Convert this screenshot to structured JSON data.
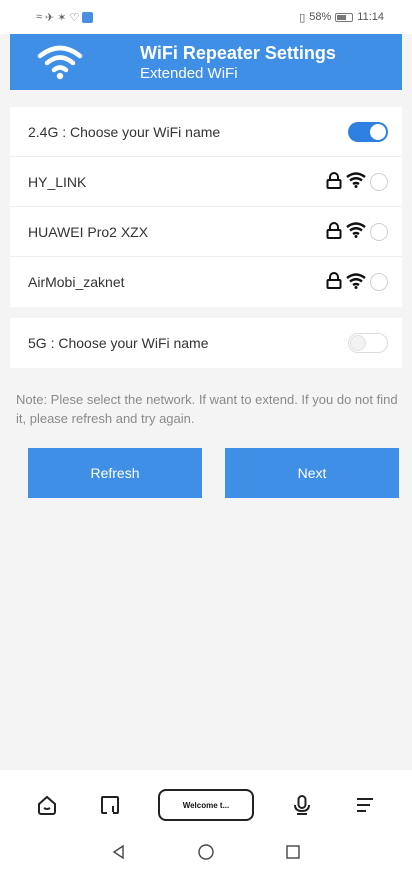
{
  "status_bar": {
    "battery_percent": "58%",
    "time": "11:14"
  },
  "header": {
    "title": "WiFi Repeater Settings",
    "subtitle": "Extended WiFi"
  },
  "band_24": {
    "label": "2.4G : Choose your WiFi name",
    "enabled": true,
    "networks": [
      {
        "name": "HY_LINK",
        "locked": true
      },
      {
        "name": "HUAWEI Pro2 XZX",
        "locked": true
      },
      {
        "name": "AirMobi_zaknet",
        "locked": true
      }
    ]
  },
  "band_5": {
    "label": "5G : Choose your WiFi name",
    "enabled": false
  },
  "note": "Note: Plese select the network. If want to extend. If you do not find it, please refresh and try again.",
  "buttons": {
    "refresh": "Refresh",
    "next": "Next"
  },
  "toolbar": {
    "welcome": "Welcome t..."
  },
  "colors": {
    "accent": "#3f8fe6",
    "toggle_on": "#2f7fe0",
    "background": "#f4f4f4"
  }
}
